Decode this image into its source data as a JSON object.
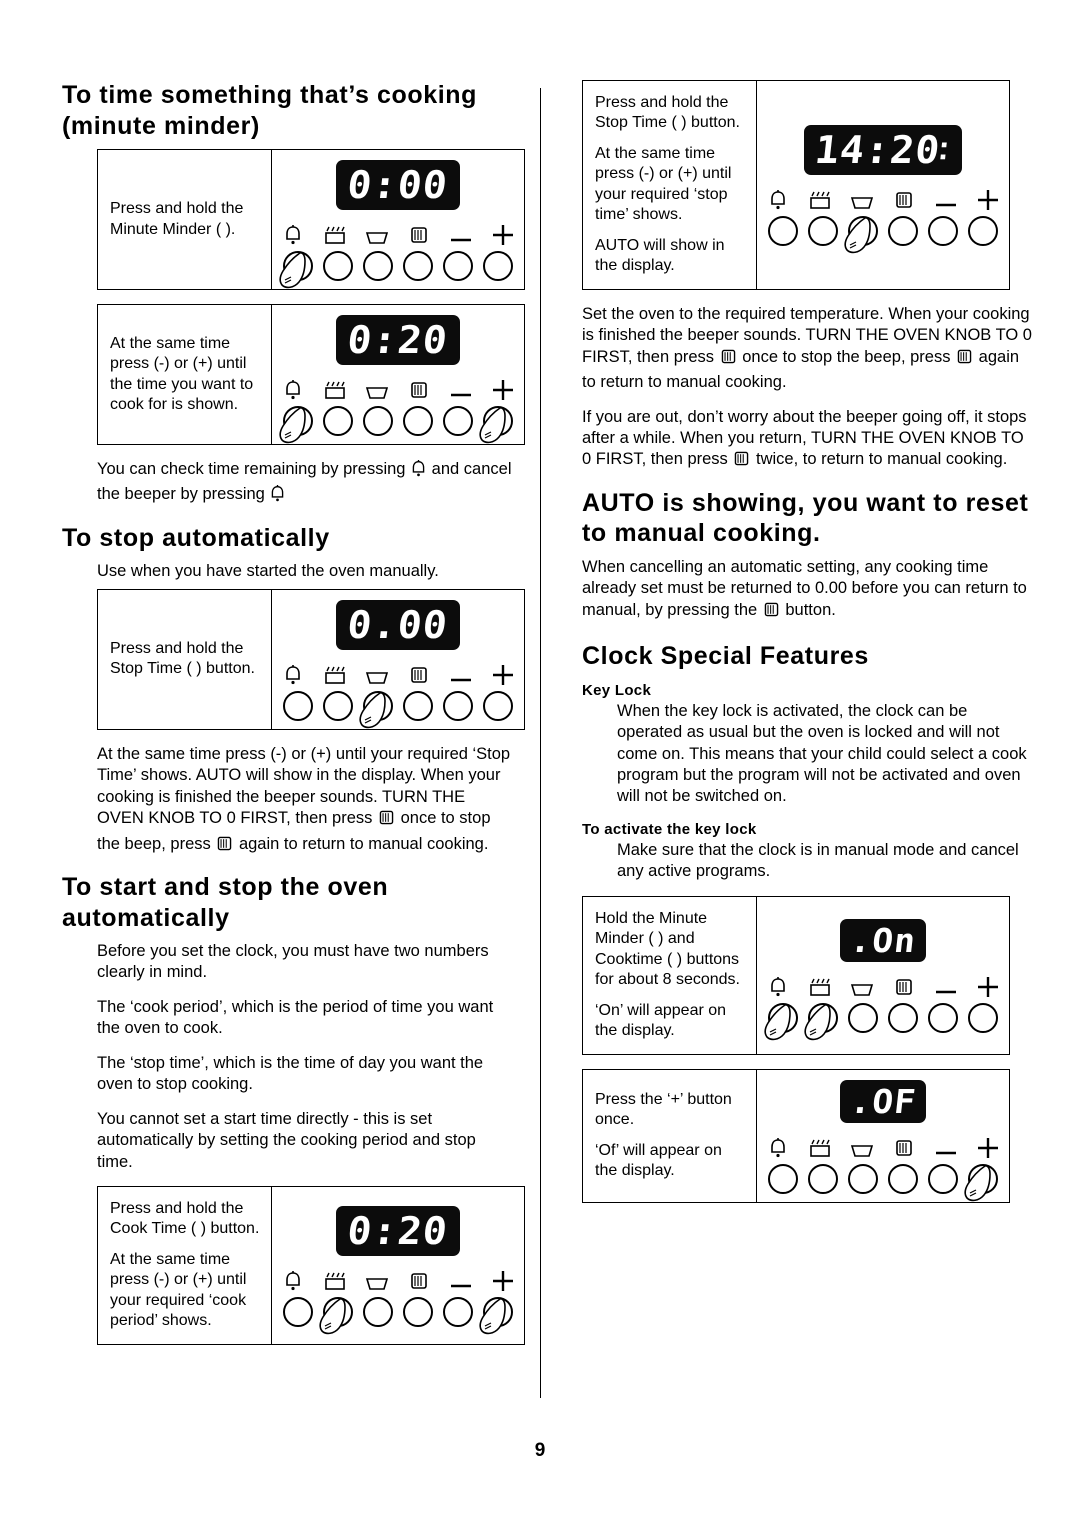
{
  "page": {
    "number": "9"
  },
  "left": {
    "h1_minute_minder": "To time something that’s cooking (minute minder)",
    "fig1": {
      "caption": "Press and hold the Minute Minder (   ).",
      "display": "0:00"
    },
    "fig2": {
      "caption": "At the same time press (-) or (+) until the time you want to cook for is shown.",
      "display": "0:20"
    },
    "p_check_remaining_a": "You can check time remaining by pressing",
    "p_check_remaining_b": "and cancel the beeper by pressing",
    "h1_stop_auto": "To stop automatically",
    "p_stop_auto_intro": "Use when you have started the oven manually.",
    "fig3": {
      "caption": "Press and hold the Stop Time (   ) button.",
      "display": "0.00"
    },
    "p_stop_auto_1": "At the same time press (-) or (+) until your required ‘Stop Time’ shows. AUTO will show in the display. When your cooking is finished the beeper sounds. TURN THE OVEN KNOB TO 0 FIRST, then press",
    "p_stop_auto_2": "once to stop the beep, press",
    "p_stop_auto_3": "again to return to manual cooking.",
    "h1_start_stop": "To start and stop the oven automatically",
    "p_ss_1": "Before you set the clock, you must have two numbers clearly in mind.",
    "p_ss_2": "The ‘cook period’, which is the period of time you want the oven to cook.",
    "p_ss_3": "The ‘stop time’, which is the time of day you want the oven to stop cooking.",
    "p_ss_4": "You cannot set a start time directly - this is set automatically by setting the cooking period and stop time.",
    "fig4": {
      "caption_a": "Press and hold the Cook Time (   ) button.",
      "caption_b": "At the same time press (-) or (+) until your required ‘cook period’ shows.",
      "display": "0:20"
    }
  },
  "right": {
    "fig5": {
      "caption_a": "Press and hold the Stop Time (   ) button.",
      "caption_b": "At the same time press (-) or (+) until your required ‘stop time’ shows.",
      "caption_c": "AUTO will show in the display.",
      "display": "14:20"
    },
    "p_r1_a": "Set the oven to the required temperature. When your cooking is finished the beeper sounds. TURN THE OVEN KNOB TO 0 FIRST, then press",
    "p_r1_b": "once to stop the beep, press",
    "p_r1_c": "again to return to manual cooking.",
    "p_r2_a": "If you are out, don’t worry about the beeper going off, it stops after a while. When you return, TURN THE OVEN KNOB TO 0 FIRST, then press",
    "p_r2_b": "twice, to return to manual cooking.",
    "h1_auto_showing": "AUTO is showing, you want to reset to manual cooking.",
    "p_auto_a": "When cancelling an automatic setting, any cooking time already set must be returned to 0.00 before you can return to manual, by pressing the",
    "p_auto_b": "button.",
    "h1_clock_special": "Clock Special Features",
    "h2_key_lock": "Key Lock",
    "p_key_lock": "When the key lock is activated, the clock can be operated as usual but the oven is locked and will not come on. This means that your child could select a cook program but the program will not be activated and oven will not be switched on.",
    "h2_activate": "To activate the key lock",
    "p_activate": "Make sure that the clock is in manual mode and cancel any active programs.",
    "fig6": {
      "caption_a": "Hold the Minute Minder (   ) and Cooktime (   ) buttons for about 8 seconds.",
      "caption_b": "‘On’ will appear on the display.",
      "display": ".On"
    },
    "fig7": {
      "caption_a": "Press the ‘+’ button once.",
      "caption_b": "‘Of’ will appear on the display.",
      "display": ".OF"
    }
  },
  "icons": {
    "minute_minder": "bell-icon",
    "cook_time": "pot-icon",
    "stop_time": "tray-icon",
    "auto_manual": "hand-icon",
    "minus": "minus-icon",
    "plus": "plus-icon"
  }
}
